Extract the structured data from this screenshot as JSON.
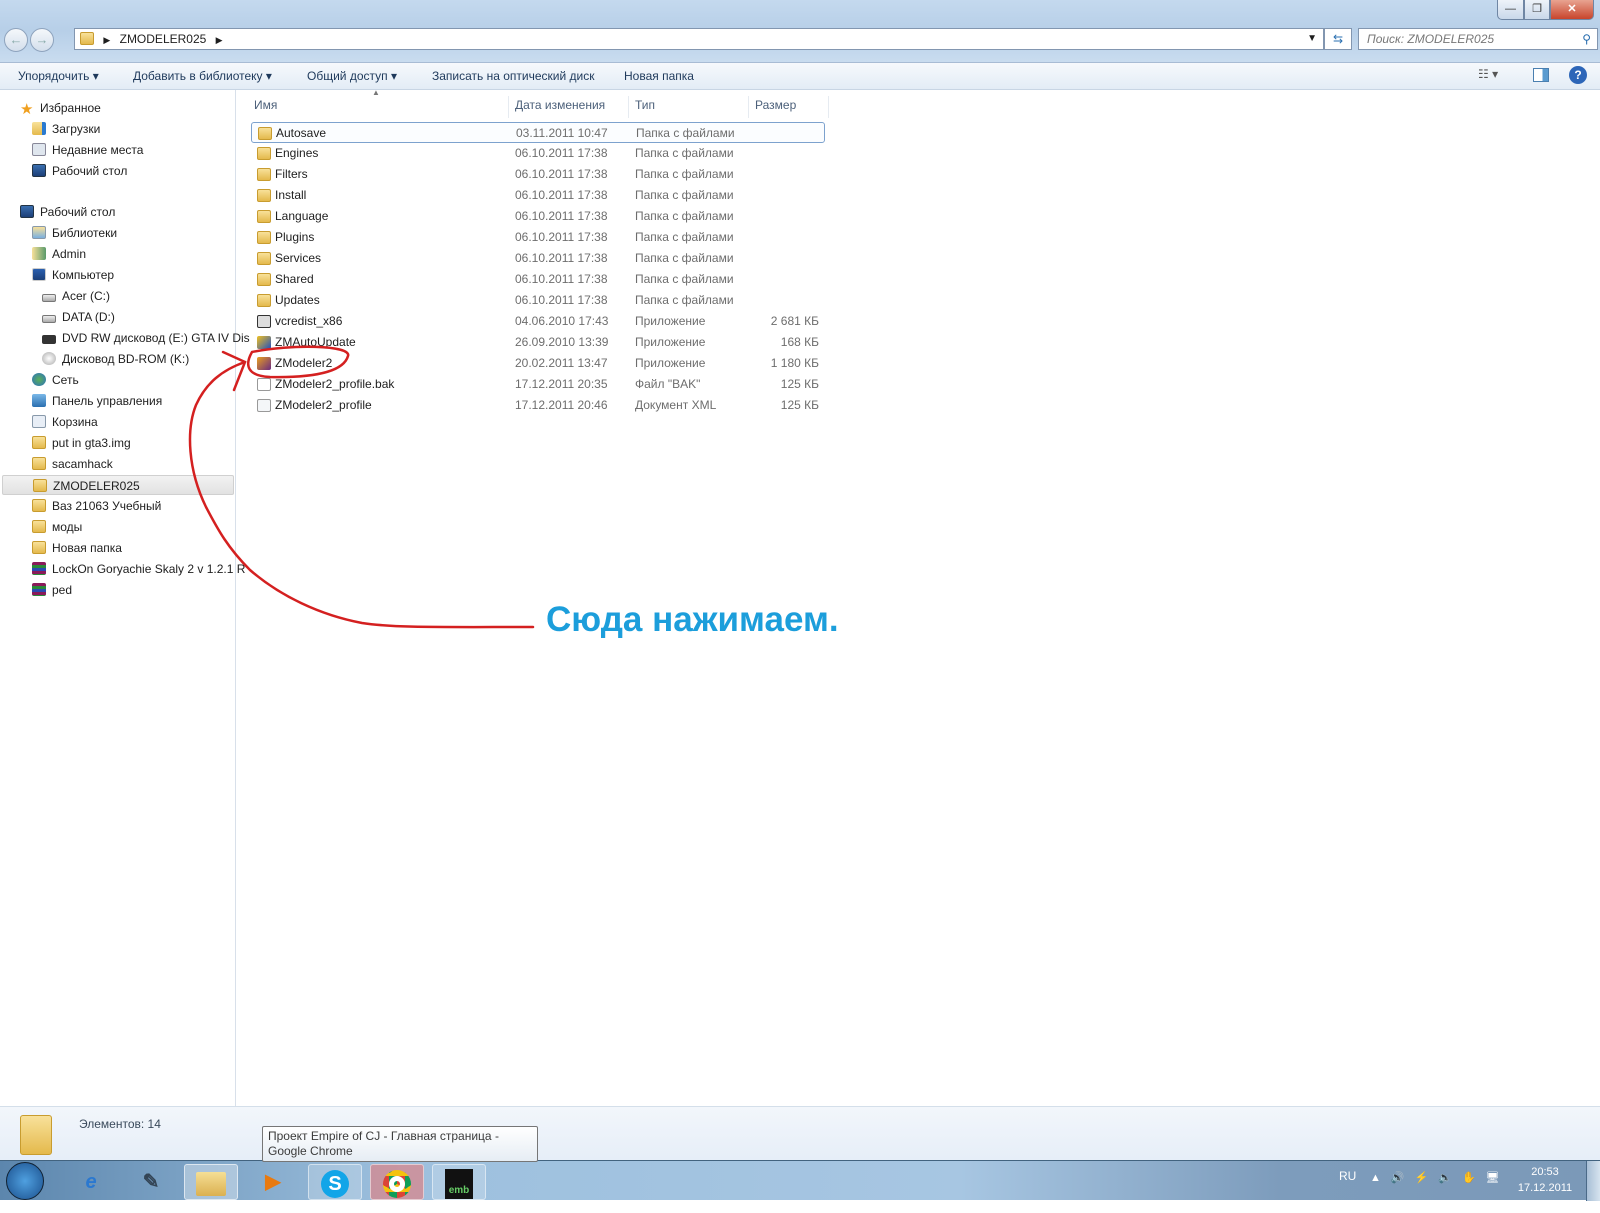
{
  "window": {
    "minimize": "—",
    "maximize": "❐",
    "close": "✕"
  },
  "nav": {
    "back": "←",
    "forward": "→",
    "breadcrumb": "ZMODELER025",
    "search_placeholder": "Поиск: ZMODELER025"
  },
  "toolbar": {
    "organize": "Упорядочить ▾",
    "add_to_library": "Добавить в библиотеку ▾",
    "share": "Общий доступ ▾",
    "burn": "Записать на оптический диск",
    "new_folder": "Новая папка"
  },
  "columns": {
    "name": "Имя",
    "date": "Дата изменения",
    "type": "Тип",
    "size": "Размер"
  },
  "sidebar": [
    {
      "label": "Избранное",
      "level": 0,
      "icon": "star"
    },
    {
      "label": "Загрузки",
      "level": 1,
      "icon": "downloads"
    },
    {
      "label": "Недавние места",
      "level": 1,
      "icon": "recent"
    },
    {
      "label": "Рабочий стол",
      "level": 1,
      "icon": "desktop"
    },
    {
      "label": "Рабочий стол",
      "level": 0,
      "icon": "desktop",
      "gap": true
    },
    {
      "label": "Библиотеки",
      "level": 1,
      "icon": "libraries"
    },
    {
      "label": "Admin",
      "level": 1,
      "icon": "user-folder"
    },
    {
      "label": "Компьютер",
      "level": 1,
      "icon": "computer"
    },
    {
      "label": "Acer (C:)",
      "level": 2,
      "icon": "drive"
    },
    {
      "label": "DATA (D:)",
      "level": 2,
      "icon": "drive"
    },
    {
      "label": "DVD RW дисковод (E:) GTA IV Dis",
      "level": 2,
      "icon": "dvd"
    },
    {
      "label": "Дисковод BD-ROM (K:)",
      "level": 2,
      "icon": "disc"
    },
    {
      "label": "Сеть",
      "level": 1,
      "icon": "network"
    },
    {
      "label": "Панель управления",
      "level": 1,
      "icon": "control-panel"
    },
    {
      "label": "Корзина",
      "level": 1,
      "icon": "recycle-bin"
    },
    {
      "label": "put in gta3.img",
      "level": 1,
      "icon": "folder"
    },
    {
      "label": "sacamhack",
      "level": 1,
      "icon": "folder"
    },
    {
      "label": "ZMODELER025",
      "level": 1,
      "icon": "folder",
      "selected": true
    },
    {
      "label": "Ваз 21063 Учебный",
      "level": 1,
      "icon": "folder"
    },
    {
      "label": "моды",
      "level": 1,
      "icon": "folder"
    },
    {
      "label": "Новая папка",
      "level": 1,
      "icon": "folder"
    },
    {
      "label": "LockOn Goryachie Skaly 2 v 1.2.1 R",
      "level": 1,
      "icon": "archive"
    },
    {
      "label": "ped",
      "level": 1,
      "icon": "archive"
    }
  ],
  "files": [
    {
      "name": "Autosave",
      "date": "03.11.2011 10:47",
      "type": "Папка с файлами",
      "size": "",
      "icon": "folder"
    },
    {
      "name": "Engines",
      "date": "06.10.2011 17:38",
      "type": "Папка с файлами",
      "size": "",
      "icon": "folder"
    },
    {
      "name": "Filters",
      "date": "06.10.2011 17:38",
      "type": "Папка с файлами",
      "size": "",
      "icon": "folder"
    },
    {
      "name": "Install",
      "date": "06.10.2011 17:38",
      "type": "Папка с файлами",
      "size": "",
      "icon": "folder"
    },
    {
      "name": "Language",
      "date": "06.10.2011 17:38",
      "type": "Папка с файлами",
      "size": "",
      "icon": "folder"
    },
    {
      "name": "Plugins",
      "date": "06.10.2011 17:38",
      "type": "Папка с файлами",
      "size": "",
      "icon": "folder"
    },
    {
      "name": "Services",
      "date": "06.10.2011 17:38",
      "type": "Папка с файлами",
      "size": "",
      "icon": "folder"
    },
    {
      "name": "Shared",
      "date": "06.10.2011 17:38",
      "type": "Папка с файлами",
      "size": "",
      "icon": "folder"
    },
    {
      "name": "Updates",
      "date": "06.10.2011 17:38",
      "type": "Папка с файлами",
      "size": "",
      "icon": "folder"
    },
    {
      "name": "vcredist_x86",
      "date": "04.06.2010 17:43",
      "type": "Приложение",
      "size": "2 681 КБ",
      "icon": "installer"
    },
    {
      "name": "ZMAutoUpdate",
      "date": "26.09.2010 13:39",
      "type": "Приложение",
      "size": "168 КБ",
      "icon": "app"
    },
    {
      "name": "ZModeler2",
      "date": "20.02.2011 13:47",
      "type": "Приложение",
      "size": "1 180 КБ",
      "icon": "zmodeler"
    },
    {
      "name": "ZModeler2_profile.bak",
      "date": "17.12.2011 20:35",
      "type": "Файл \"BAK\"",
      "size": "125 КБ",
      "icon": "file"
    },
    {
      "name": "ZModeler2_profile",
      "date": "17.12.2011 20:46",
      "type": "Документ XML",
      "size": "125 КБ",
      "icon": "xml"
    }
  ],
  "status": {
    "count": "Элементов: 14"
  },
  "tooltip": "Проект Empire of CJ - Главная страница - Google Chrome",
  "annotation": "Сюда нажимаем.",
  "tray": {
    "lang": "RU",
    "time": "20:53",
    "date": "17.12.2011"
  },
  "colors": {
    "annotation": "#1c9edb",
    "annotation_stroke": "#d42020",
    "selection": "#7da2ce"
  }
}
